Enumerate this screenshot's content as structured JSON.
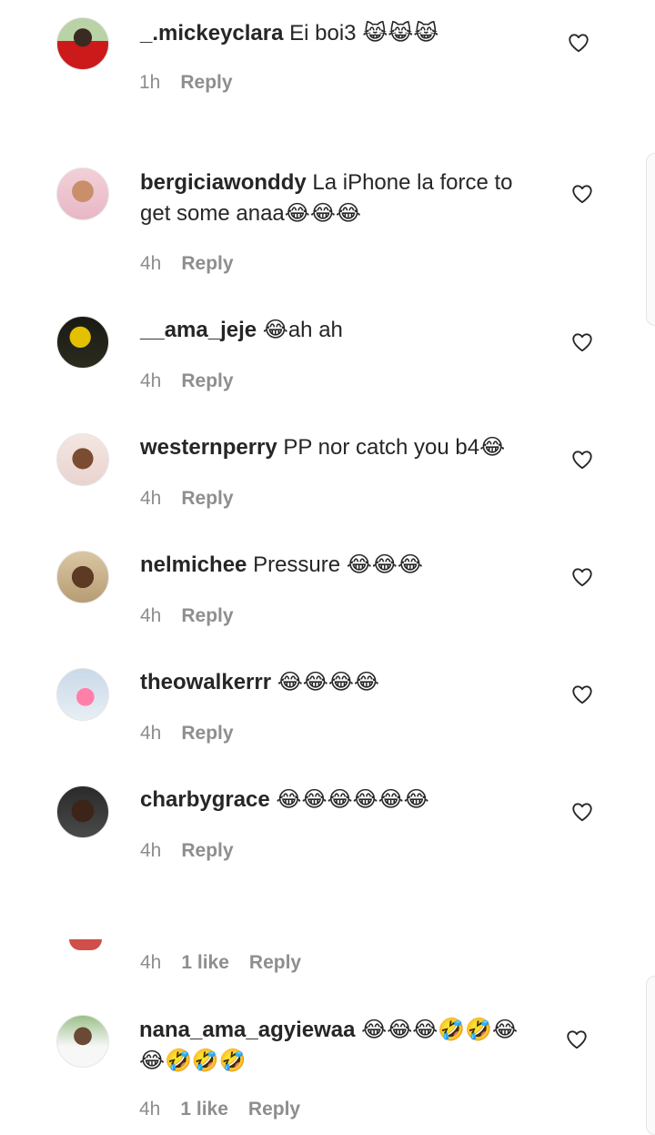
{
  "comments": [
    {
      "username": "_.mickeyclara",
      "text": "Ei boi3 😹😹😹",
      "time": "1h",
      "reply": "Reply"
    },
    {
      "username": "bergiciawonddy",
      "text": "La iPhone la force to get some anaa😂😂😂",
      "time": "4h",
      "reply": "Reply"
    },
    {
      "username": "__ama_jeje",
      "text": "😂ah ah",
      "time": "4h",
      "reply": "Reply"
    },
    {
      "username": "westernperry",
      "text": "PP nor catch you b4😂",
      "time": "4h",
      "reply": "Reply"
    },
    {
      "username": "nelmichee",
      "text": "Pressure 😂😂😂",
      "time": "4h",
      "reply": "Reply"
    },
    {
      "username": "theowalkerrr",
      "text": "😂😂😂😂",
      "time": "4h",
      "reply": "Reply"
    },
    {
      "username": "charbygrace",
      "text": "😂😂😂😂😂😂",
      "time": "4h",
      "reply": "Reply"
    }
  ],
  "partial_comment": {
    "time": "4h",
    "likes": "1 like",
    "reply": "Reply"
  },
  "last_comment": {
    "username": "nana_ama_agyiewaa",
    "text": "😂😂😂🤣🤣😂😂🤣🤣🤣",
    "time": "4h",
    "likes": "1 like",
    "reply": "Reply"
  },
  "icons": {
    "like": "heart-outline-icon"
  },
  "colors": {
    "text": "#262626",
    "secondary": "#8e8e8e",
    "background": "#ffffff"
  }
}
